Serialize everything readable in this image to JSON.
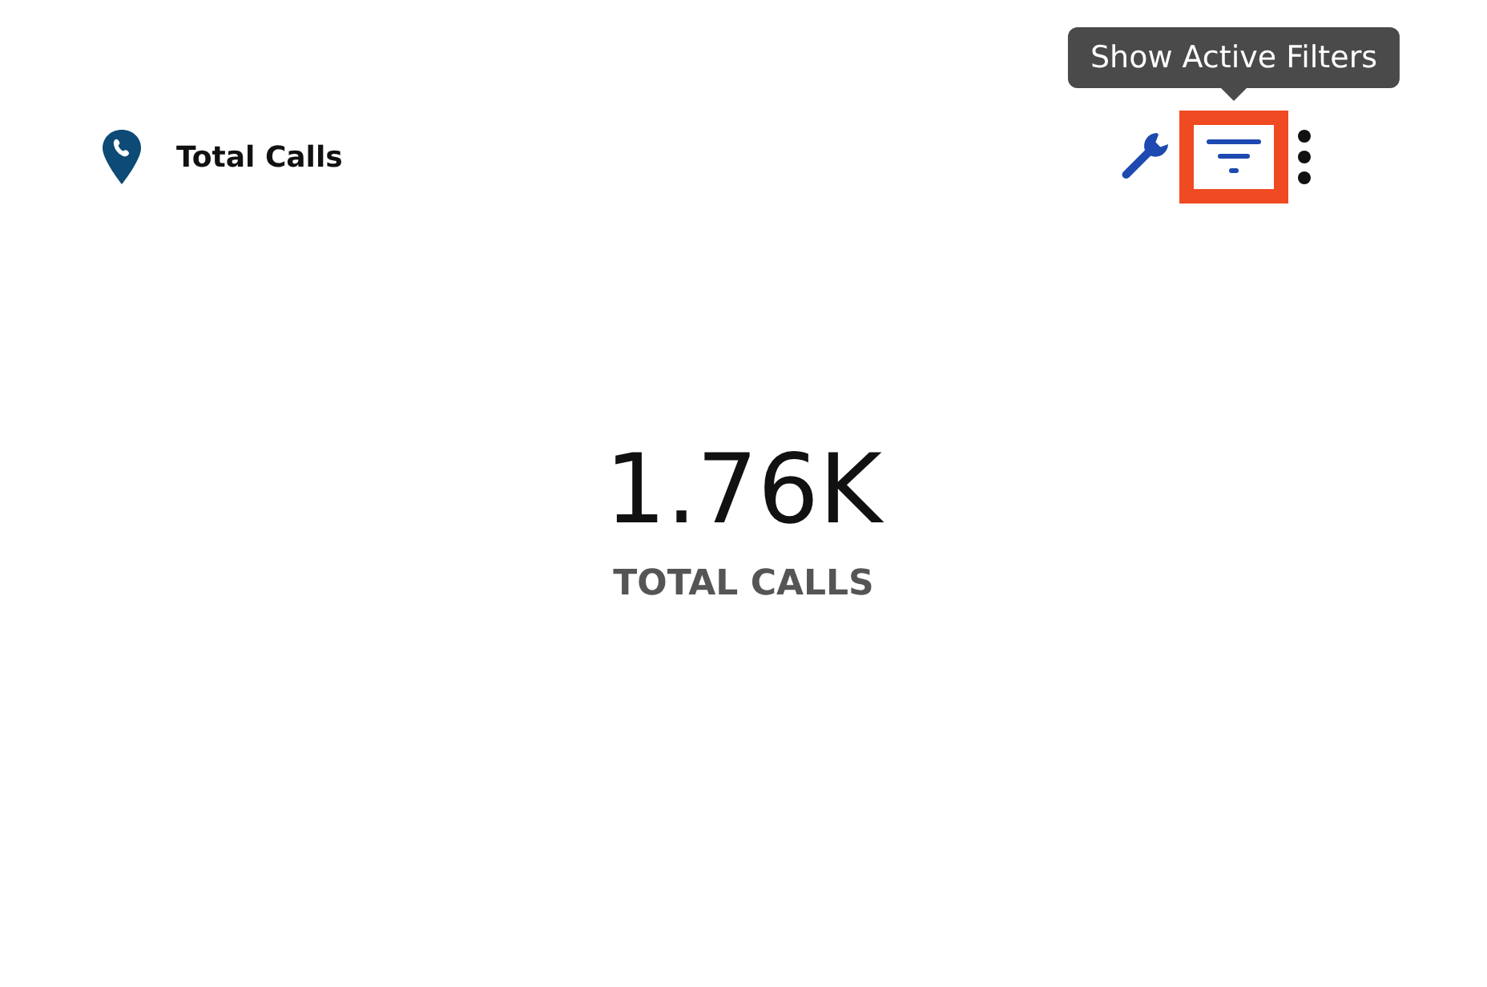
{
  "header": {
    "title": "Total Calls"
  },
  "toolbar": {
    "filter_button": {
      "highlighted": true
    },
    "tooltip": "Show Active Filters"
  },
  "metric": {
    "value": "1.76K",
    "label": "TOTAL CALLS"
  }
}
